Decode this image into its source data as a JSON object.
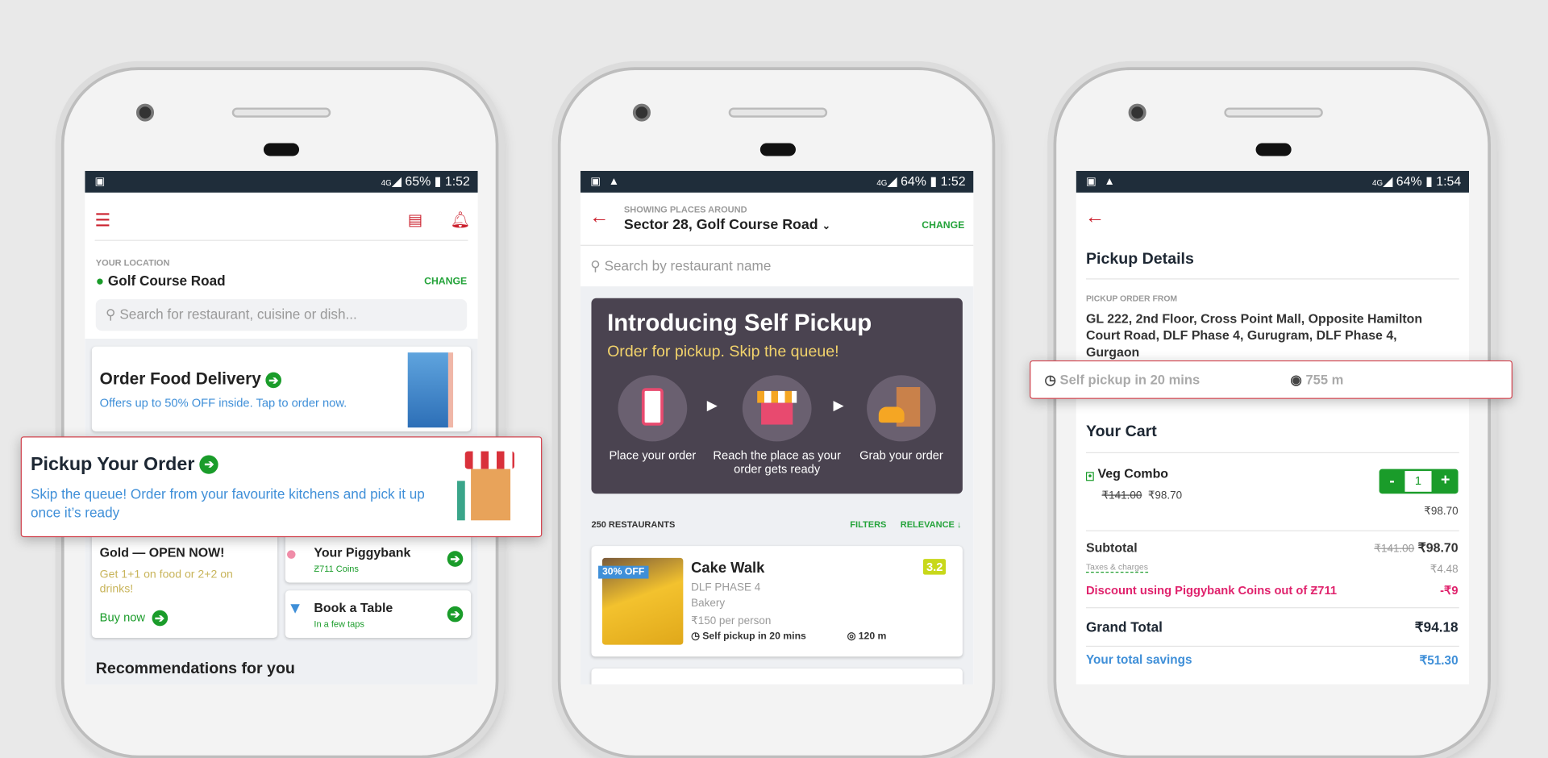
{
  "phone1": {
    "status": {
      "battery": "65%",
      "time": "1:52"
    },
    "location_label": "YOUR LOCATION",
    "location": "Golf Course Road",
    "change": "CHANGE",
    "search_placeholder": "Search for restaurant, cuisine or dish...",
    "delivery": {
      "title": "Order Food Delivery",
      "subtitle": "Offers up to 50% OFF inside. Tap to order now."
    },
    "pickup": {
      "title": "Pickup Your Order",
      "subtitle": "Skip the queue! Order from your favourite kitchens and pick it up once it’s ready"
    },
    "gold": {
      "title": "Gold — OPEN NOW!",
      "subtitle": "Get 1+1 on food or 2+2 on drinks!",
      "cta": "Buy now"
    },
    "piggybank": {
      "title": "Your Piggybank",
      "subtitle": "Ƶ711 Coins"
    },
    "table": {
      "title": "Book a Table",
      "subtitle": "In a few taps"
    },
    "recommendations": "Recommendations for you"
  },
  "phone2": {
    "status": {
      "battery": "64%",
      "time": "1:52"
    },
    "showing": "SHOWING PLACES AROUND",
    "location": "Sector 28, Golf Course Road",
    "change": "CHANGE",
    "search_placeholder": "Search by restaurant name",
    "banner": {
      "title": "Introducing Self Pickup",
      "subtitle": "Order for pickup. Skip the queue!",
      "steps": [
        "Place your order",
        "Reach the place as your order gets ready",
        "Grab your order"
      ]
    },
    "count": "250 RESTAURANTS",
    "filters": "FILTERS",
    "sort": "RELEVANCE ↓",
    "restaurant": {
      "offer": "30% OFF",
      "name": "Cake Walk",
      "rating": "3.2",
      "area": "DLF PHASE 4",
      "cuisine": "Bakery",
      "cost": "₹150 per person",
      "pickup": "Self pickup in 20 mins",
      "distance": "120 m"
    }
  },
  "phone3": {
    "status": {
      "battery": "64%",
      "time": "1:54"
    },
    "title": "Pickup Details",
    "from_label": "PICKUP ORDER FROM",
    "address": "GL 222, 2nd Floor, Cross Point Mall, Opposite Hamilton Court Road, DLF Phase 4, Gurugram, DLF Phase 4, Gurgaon",
    "pickup_time": "Self pickup in 20 mins",
    "distance": "755 m",
    "cart_title": "Your Cart",
    "item": {
      "name": "Veg Combo",
      "old_price": "₹141.00",
      "price": "₹98.70",
      "qty": "1",
      "minus": "-",
      "plus": "+",
      "total": "₹98.70"
    },
    "subtotal": {
      "label": "Subtotal",
      "old": "₹141.00",
      "value": "₹98.70"
    },
    "taxes": {
      "label": "Taxes & charges",
      "value": "₹4.48"
    },
    "discount": {
      "label": "Discount using Piggybank Coins out of Ƶ711",
      "value": "-₹9"
    },
    "grand": {
      "label": "Grand Total",
      "value": "₹94.18"
    },
    "savings": {
      "label": "Your total savings",
      "value": "₹51.30"
    }
  },
  "colors": {
    "brand_red": "#cb202d",
    "green": "#1a9c2a",
    "link_blue": "#3f8fd8",
    "banner_bg": "#4a4350",
    "discount_pink": "#e0236d"
  }
}
